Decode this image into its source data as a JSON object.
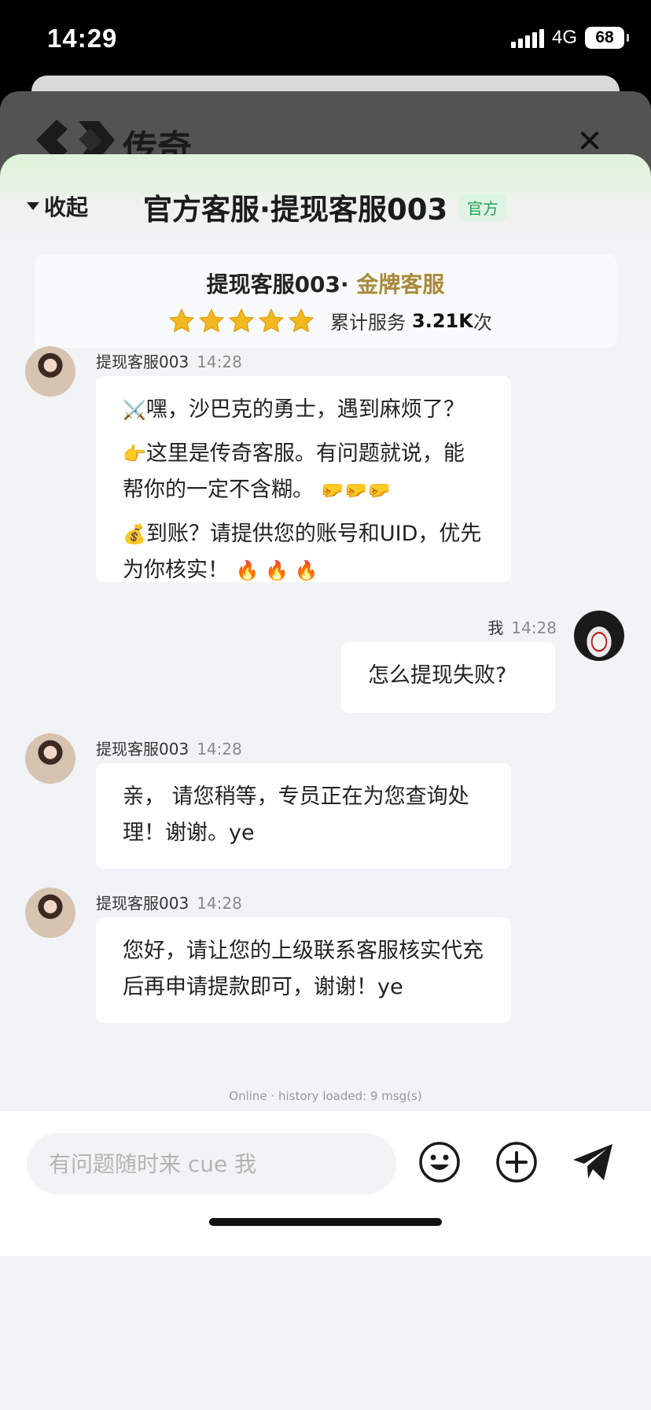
{
  "status_bar": {
    "time": "14:29",
    "network": "4G",
    "battery": "68"
  },
  "background_page": {
    "logo_text": "传奇",
    "close_glyph": "✕"
  },
  "header": {
    "collapse_label": "收起",
    "title": "官方客服·提现客服003",
    "badge": "官方"
  },
  "agent_card": {
    "name": "提现客服003·",
    "level": "金牌客服",
    "rating_stars": 5,
    "served_prefix": "累计服务",
    "served_count": "3.21K",
    "served_suffix": "次"
  },
  "messages": [
    {
      "sender": "提现客服003",
      "time": "14:28",
      "side": "left",
      "lines": [
        {
          "emoji": "⚔️",
          "text": "嘿，沙巴克的勇士，遇到麻烦了？"
        },
        {
          "emoji": "👉",
          "text": "这里是传奇客服。有问题就说，能帮你的一定不含糊。",
          "trail": "🤛🤛🤛"
        },
        {
          "emoji": "💰",
          "text": "到账？请提供您的账号和UID，优先为你核实！",
          "trail": "🔥 🔥 🔥"
        }
      ]
    },
    {
      "sender": "我",
      "time": "14:28",
      "side": "right",
      "text": "怎么提现失败?"
    },
    {
      "sender": "提现客服003",
      "time": "14:28",
      "side": "left",
      "text": "亲， 请您稍等，专员正在为您查询处理！谢谢。ye"
    },
    {
      "sender": "提现客服003",
      "time": "14:28",
      "side": "left",
      "text": "您好，请让您的上级联系客服核实代充后再申请提款即可，谢谢！ye"
    }
  ],
  "status_line": "Online · history loaded: 9 msg(s)",
  "input": {
    "placeholder": "有问题随时来 cue 我",
    "value": ""
  },
  "icons": {
    "emoji": "emoji-icon",
    "add": "plus-icon",
    "send": "send-icon"
  },
  "colors": {
    "official_badge": "#22a45d",
    "gold_level": "#a88a3b",
    "star": "#f2b81f"
  }
}
